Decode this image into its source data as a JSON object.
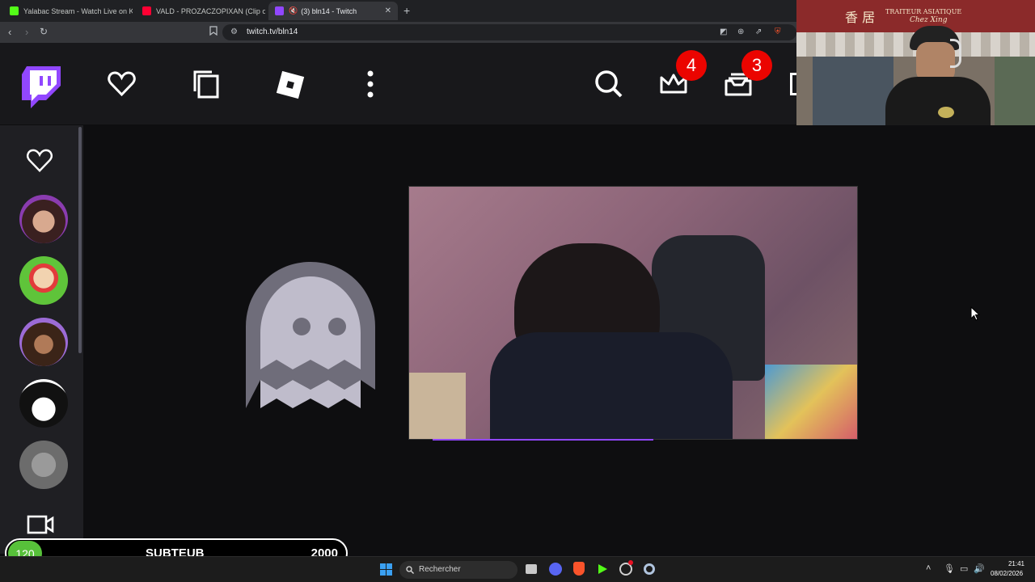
{
  "browser": {
    "tabs": [
      {
        "label": "Yalabac Stream - Watch Live on Kick",
        "favicon_color": "#53fc18"
      },
      {
        "label": "VALD - PROZACZOPIXAN (Clip offici...",
        "favicon_color": "#ff0033"
      },
      {
        "label": "(3) bln14 - Twitch",
        "favicon_color": "#9147ff"
      }
    ],
    "new_tab_symbol": "+",
    "close_symbol": "✕",
    "url": "twitch.tv/bln14"
  },
  "twitch": {
    "brand_color": "#9147ff",
    "notifications_count": "4",
    "inbox_count": "3",
    "top_nav_icons": [
      "twitch-logo-icon",
      "following-heart-icon",
      "browse-copy-icon",
      "roblox-icon",
      "more-vertical-icon",
      "search-icon",
      "crown-icon",
      "inbox-icon"
    ],
    "sidebar_icons": [
      "followed-heart-icon",
      "camera-icon"
    ],
    "offline_icon": "ghost-icon"
  },
  "subgoal": {
    "count": "120",
    "label": "SUBTEUB",
    "target": "2000",
    "accent": "#57c13a"
  },
  "webcam": {
    "sign_line1": "TRAITEUR ASIATIQUE",
    "sign_line2": "Chez Xing",
    "sign_chinese": "香 居"
  },
  "taskbar": {
    "search_placeholder": "Rechercher",
    "time": "21:41",
    "date": "08/02/2026"
  }
}
